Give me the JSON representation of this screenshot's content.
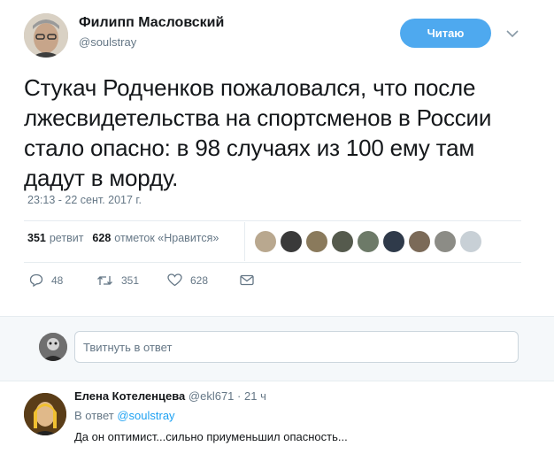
{
  "tweet": {
    "author_name": "Филипп Масловский",
    "author_handle": "@soulstray",
    "follow_label": "Читаю",
    "text": "Стукач Родченков пожаловался, что после лжесвидетельства на спортсменов в России стало опасно: в 98 случаях из 100 ему там дадут в морду.",
    "timestamp": "23:13 - 22 сент. 2017 г.",
    "retweets_count": "351",
    "retweets_label": "ретвит",
    "likes_count": "628",
    "likes_label": "отметок «Нравится»",
    "actions": {
      "reply_count": "48",
      "retweet_count": "351",
      "like_count": "628"
    },
    "likers_colors": [
      "#b9a88f",
      "#3a3a3a",
      "#8a7a5c",
      "#555a4d",
      "#6d7a68",
      "#2f3a4a",
      "#7b6a58",
      "#8c8c86",
      "#c8d0d6"
    ]
  },
  "reply_box": {
    "placeholder": "Твитнуть в ответ"
  },
  "reply": {
    "name": "Елена Котеленцева",
    "handle": "@ekl671",
    "time": "21 ч",
    "in_reply_prefix": "В ответ",
    "in_reply_to": "@soulstray",
    "text": "Да он оптимист...сильно приуменьшил опасность..."
  },
  "colors": {
    "accent": "#1da1f2",
    "follow_button": "#4ea9ef",
    "muted": "#657786"
  }
}
